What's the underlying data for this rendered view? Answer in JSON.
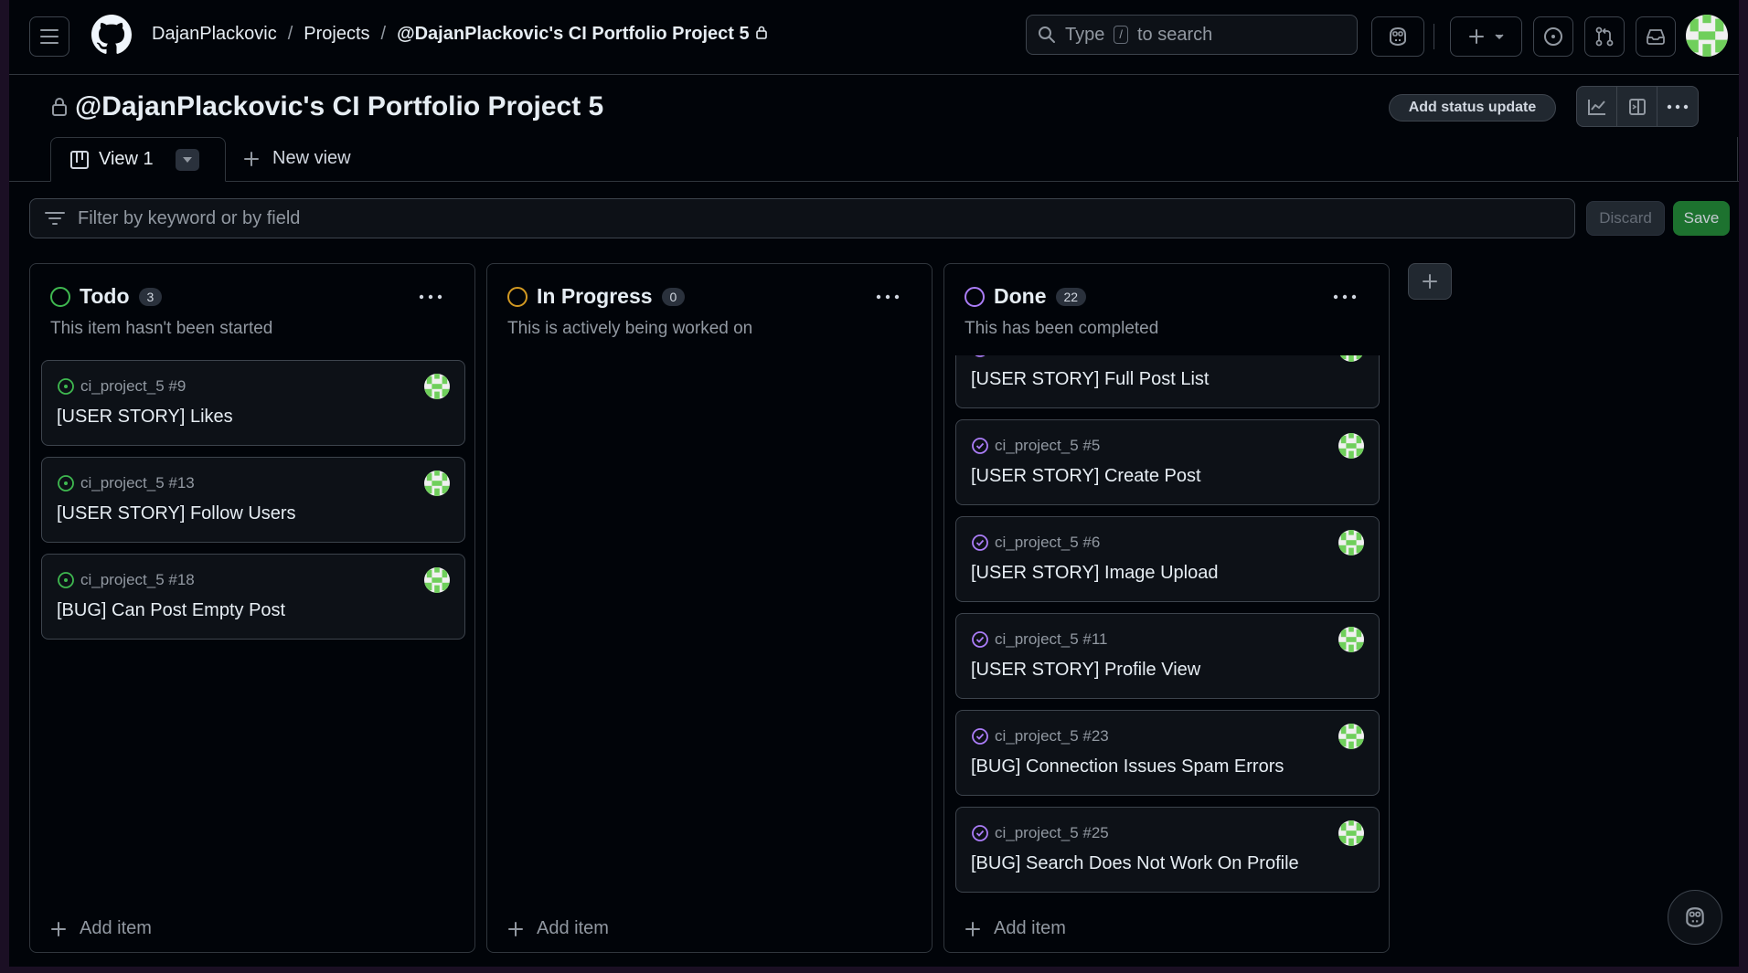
{
  "header": {
    "breadcrumbs": [
      "DajanPlackovic",
      "Projects",
      "@DajanPlackovic's CI Portfolio Project 5"
    ],
    "search_prefix": "Type",
    "search_key": "/",
    "search_suffix": "to search"
  },
  "project": {
    "title": "@DajanPlackovic's CI Portfolio Project 5",
    "status_button": "Add status update"
  },
  "tabs": {
    "current": "View 1",
    "new_view": "New view"
  },
  "filter": {
    "placeholder": "Filter by keyword or by field",
    "discard": "Discard",
    "save": "Save"
  },
  "columns": [
    {
      "name": "Todo",
      "count": "3",
      "description": "This item hasn't been started",
      "color": "#3fb950",
      "add_item": "Add item",
      "cards": [
        {
          "ref": "ci_project_5 #9",
          "title": "[USER STORY] Likes"
        },
        {
          "ref": "ci_project_5 #13",
          "title": "[USER STORY] Follow Users"
        },
        {
          "ref": "ci_project_5 #18",
          "title": "[BUG] Can Post Empty Post"
        }
      ]
    },
    {
      "name": "In Progress",
      "count": "0",
      "description": "This is actively being worked on",
      "color": "#d29922",
      "add_item": "Add item",
      "cards": []
    },
    {
      "name": "Done",
      "count": "22",
      "description": "This has been completed",
      "color": "#ab7df8",
      "add_item": "Add item",
      "cards": [
        {
          "ref": "",
          "title": "[USER STORY] Full Post List"
        },
        {
          "ref": "ci_project_5 #5",
          "title": "[USER STORY] Create Post"
        },
        {
          "ref": "ci_project_5 #6",
          "title": "[USER STORY] Image Upload"
        },
        {
          "ref": "ci_project_5 #11",
          "title": "[USER STORY] Profile View"
        },
        {
          "ref": "ci_project_5 #23",
          "title": "[BUG] Connection Issues Spam Errors"
        },
        {
          "ref": "ci_project_5 #25",
          "title": "[BUG] Search Does Not Work On Profile"
        }
      ]
    }
  ],
  "colors": {
    "open": "#3fb950",
    "in_progress": "#d29922",
    "done": "#ab7df8",
    "save": "#238636",
    "avatar": "#6fcf5b"
  },
  "icons": [
    "hamburger-icon",
    "github-logo-icon",
    "lock-icon",
    "search-icon",
    "copilot-icon",
    "plus-icon",
    "issue-opened-icon",
    "pull-request-icon",
    "inbox-icon",
    "insights-icon",
    "sidebar-icon",
    "kebab-icon",
    "board-icon",
    "filter-icon",
    "issue-closed-icon"
  ]
}
